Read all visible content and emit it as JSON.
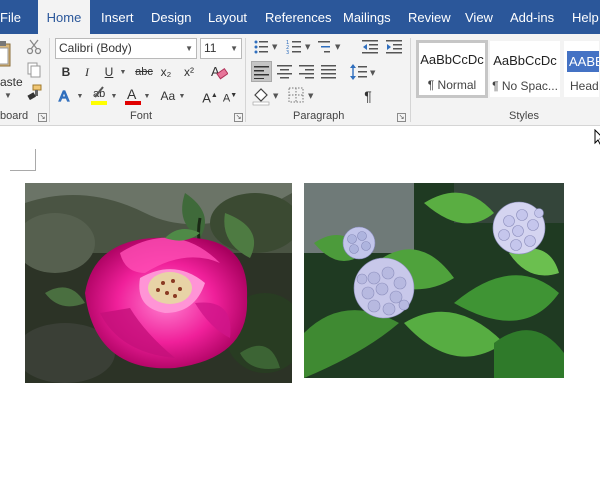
{
  "tabs": [
    "File",
    "Home",
    "Insert",
    "Design",
    "Layout",
    "References",
    "Mailings",
    "Review",
    "View",
    "Add-ins",
    "Help"
  ],
  "clipboard": {
    "paste_label": "aste",
    "group_label": "board"
  },
  "font": {
    "name": "Calibri (Body)",
    "size": "11",
    "group_label": "Font",
    "bold": "B",
    "italic": "I",
    "underline": "U",
    "strike": "abc",
    "subscript": "x₂",
    "superscript": "x²",
    "grow": "A",
    "shrink": "A",
    "case": "Aa"
  },
  "paragraph": {
    "group_label": "Paragraph",
    "pilcrow": "¶"
  },
  "styles": {
    "group_label": "Styles",
    "items": [
      {
        "sample": "AaBbCcDc",
        "name": "¶ Normal"
      },
      {
        "sample": "AaBbCcDc",
        "name": "¶ No Spac..."
      },
      {
        "sample": "AABB",
        "name": "Headi"
      }
    ]
  },
  "document": {
    "images": [
      {
        "subject": "pink rose"
      },
      {
        "subject": "lilac hydrangea"
      }
    ]
  },
  "colors": {
    "tab_bar": "#2b579a",
    "ribbon": "#f3f3f3",
    "highlight": "#ffff00",
    "font_color": "#e00000",
    "heading_style": "#4472c4"
  }
}
